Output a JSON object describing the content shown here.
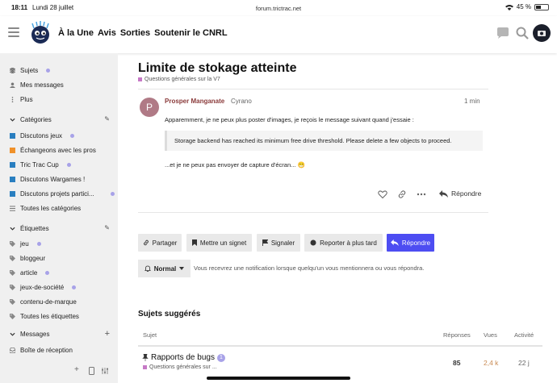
{
  "status_bar": {
    "time": "18:11",
    "date": "Lundi 28 juillet",
    "url": "forum.trictrac.net",
    "battery": "45 %",
    "battery_level": 0.45
  },
  "header": {
    "nav": [
      "À la Une",
      "Avis",
      "Sorties",
      "Soutenir le CNRL"
    ],
    "icons": [
      "hamburger-menu-icon",
      "chat-icon",
      "search-icon",
      "menu-icon"
    ]
  },
  "sidebar": {
    "top": [
      {
        "label": "Sujets",
        "icon": "layers-icon",
        "dot": true
      },
      {
        "label": "Mes messages",
        "icon": "user-icon",
        "dot": false
      },
      {
        "label": "Plus",
        "icon": "more-vertical-icon",
        "dot": false
      }
    ],
    "categories_header": "Catégories",
    "categories": [
      {
        "label": "Discutons jeux",
        "color": "#2a7fc0",
        "dot": true
      },
      {
        "label": "Échangeons avec les pros",
        "color": "#f0912a",
        "dot": false
      },
      {
        "label": "Tric Trac Cup",
        "color": "#2a7fc0",
        "dot": true
      },
      {
        "label": "Discutons Wargames !",
        "color": "#2a7fc0",
        "dot": false
      },
      {
        "label": "Discutons projets partici...",
        "color": "#2a7fc0",
        "dot": true
      },
      {
        "label": "Toutes les catégories",
        "icon": "list-icon",
        "dot": false
      }
    ],
    "tags_header": "Étiquettes",
    "tags": [
      {
        "label": "jeu",
        "dot": true
      },
      {
        "label": "bloggeur",
        "dot": false
      },
      {
        "label": "article",
        "dot": true
      },
      {
        "label": "jeux-de-société",
        "dot": true
      },
      {
        "label": "contenu-de-marque",
        "dot": false
      },
      {
        "label": "Toutes les étiquettes",
        "dot": false
      }
    ],
    "messages_header": "Messages",
    "messages": [
      {
        "label": "Boîte de réception"
      }
    ]
  },
  "topic": {
    "title": "Limite de stokage atteinte",
    "category": "Questions générales sur la V7",
    "category_color": "#c679c6"
  },
  "post": {
    "avatar_letter": "P",
    "author": "Prosper Manganate",
    "username": "Cyrano",
    "time": "1 min",
    "text1": "Apparemment, je ne peux plus poster d'images, je reçois le message suivant quand j'essaie :",
    "quote": "Storage backend has reached its minimum free drive threshold. Please delete a few objects to proceed.",
    "text2": "...et je ne peux pas envoyer de capture d'écran... 😁",
    "reply_label": "Répondre"
  },
  "actions": {
    "share": "Partager",
    "bookmark": "Mettre un signet",
    "flag": "Signaler",
    "defer": "Reporter à plus tard",
    "reply": "Répondre"
  },
  "notification": {
    "level": "Normal",
    "text": "Vous recevrez une notification lorsque quelqu'un vous mentionnera ou vous répondra."
  },
  "suggested": {
    "title": "Sujets suggérés",
    "columns": [
      "Sujet",
      "Réponses",
      "Vues",
      "Activité"
    ],
    "rows": [
      {
        "title": "Rapports de bugs",
        "badge": "1",
        "category": "Questions générales sur ...",
        "replies": "85",
        "views": "2,4 k",
        "activity": "22 j"
      }
    ]
  }
}
